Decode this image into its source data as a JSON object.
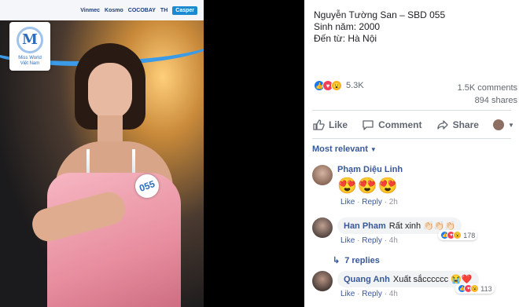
{
  "photo": {
    "sponsors": [
      "Vinmec",
      "Kosmo",
      "COCOBAY",
      "TH",
      "Casper"
    ],
    "logo_text": "Miss World",
    "logo_subtext": "Việt Nam",
    "badge_number": "055"
  },
  "post": {
    "caption_lines": [
      "Nguyễn Tường San – SBD 055",
      "Sinh năm: 2000",
      "Đến từ: Hà Nội"
    ],
    "reaction_count": "5.3K",
    "comments_count": "1.5K comments",
    "shares_count": "894 shares"
  },
  "actions": {
    "like": "Like",
    "comment": "Comment",
    "share": "Share"
  },
  "sort_label": "Most relevant",
  "comments": [
    {
      "name": "Phạm Diệu Linh",
      "text": "😍😍😍",
      "like": "Like",
      "reply": "Reply",
      "time": "2h"
    },
    {
      "name": "Han Pham",
      "text": "Rất xinh 👏🏻👏🏻👏🏻",
      "like": "Like",
      "reply": "Reply",
      "time": "4h",
      "reactions": "178"
    },
    {
      "name": "Quang Anh",
      "text": "Xuất sắcccccc 😭❤️",
      "like": "Like",
      "reply": "Reply",
      "time": "4h",
      "reactions": "113"
    }
  ],
  "replies_label": "7 replies",
  "colors": {
    "accent": "#385898",
    "like_blue": "#1877f2",
    "love_red": "#f33e58",
    "wow_yellow": "#f7b125"
  }
}
